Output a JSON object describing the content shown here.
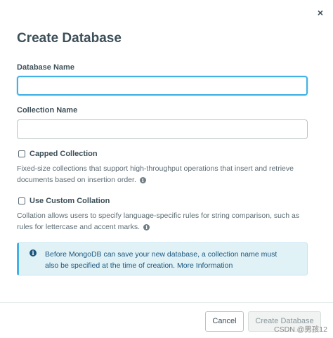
{
  "dialog": {
    "title": "Create Database",
    "close_glyph": "×"
  },
  "fields": {
    "database_name": {
      "label": "Database Name",
      "value": "",
      "placeholder": ""
    },
    "collection_name": {
      "label": "Collection Name",
      "value": "",
      "placeholder": ""
    }
  },
  "options": {
    "capped": {
      "label": "Capped Collection",
      "checked": false,
      "description": "Fixed-size collections that support high-throughput operations that insert and retrieve documents based on insertion order."
    },
    "collation": {
      "label": "Use Custom Collation",
      "checked": false,
      "description": "Collation allows users to specify language-specific rules for string comparison, such as rules for lettercase and accent marks."
    }
  },
  "banner": {
    "text": "Before MongoDB can save your new database, a collection name must also be specified at the time of creation.",
    "link": "More Information"
  },
  "footer": {
    "cancel_label": "Cancel",
    "create_label": "Create Database"
  },
  "watermark": "CSDN @男孩12",
  "icons": {
    "close": "close-icon",
    "info": "info-icon",
    "banner_info": "info-circle-icon"
  },
  "colors": {
    "focus_border": "#43b1e5",
    "banner_bg": "#e1f2f6",
    "banner_text": "#1a567e",
    "disabled_button_bg": "#f0f3f2"
  }
}
